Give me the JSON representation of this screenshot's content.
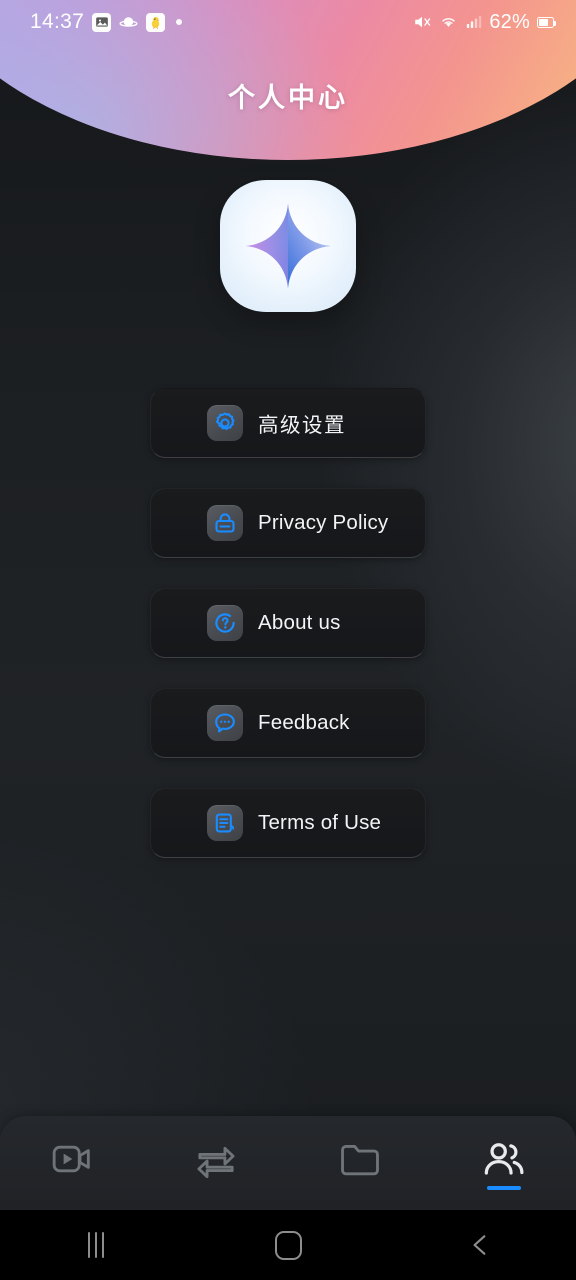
{
  "status_bar": {
    "time": "14:37",
    "icons": [
      "photo-icon",
      "saturn-icon",
      "chick-icon",
      "dot-indicator"
    ],
    "right_icons": [
      "mute-icon",
      "wifi-icon",
      "signal-icon"
    ],
    "battery_percent": "62%",
    "battery_level": 62
  },
  "header": {
    "title": "个人中心",
    "gradient": {
      "from": "#a9c4f0",
      "mid": "#d98fc0",
      "to": "#f9cc92"
    }
  },
  "logo": {
    "name": "app-logo",
    "shape": "squircle",
    "glyph": "four-point-star-sparkle",
    "background": "#ffffff",
    "star_gradient_from": "#ff86d8",
    "star_gradient_mid": "#6f8ef0",
    "star_gradient_to": "#2f6bd8"
  },
  "menu": {
    "items": [
      {
        "id": "advanced-settings",
        "label": "高级设置",
        "icon": "gear-icon",
        "cjk": true
      },
      {
        "id": "privacy-policy",
        "label": "Privacy Policy",
        "icon": "lock-icon",
        "cjk": false
      },
      {
        "id": "about-us",
        "label": "About us",
        "icon": "question-circle-icon",
        "cjk": false
      },
      {
        "id": "feedback",
        "label": "Feedback",
        "icon": "chat-bubble-icon",
        "cjk": false
      },
      {
        "id": "terms-of-use",
        "label": "Terms of Use",
        "icon": "document-icon",
        "cjk": false
      }
    ],
    "icon_accent": "#1a8cff"
  },
  "tabbar": {
    "active_index": 3,
    "active_color": "#1a8cff",
    "inactive_color": "#6f7479",
    "tabs": [
      {
        "id": "tab-recorder",
        "icon": "video-camera-icon"
      },
      {
        "id": "tab-transfer",
        "icon": "transfer-arrows-icon"
      },
      {
        "id": "tab-files",
        "icon": "folder-icon"
      },
      {
        "id": "tab-profile",
        "icon": "people-icon"
      }
    ]
  },
  "system_nav": {
    "buttons": [
      {
        "id": "nav-recents",
        "icon": "recents-icon"
      },
      {
        "id": "nav-home",
        "icon": "home-icon"
      },
      {
        "id": "nav-back",
        "icon": "back-chevron-icon"
      }
    ]
  }
}
